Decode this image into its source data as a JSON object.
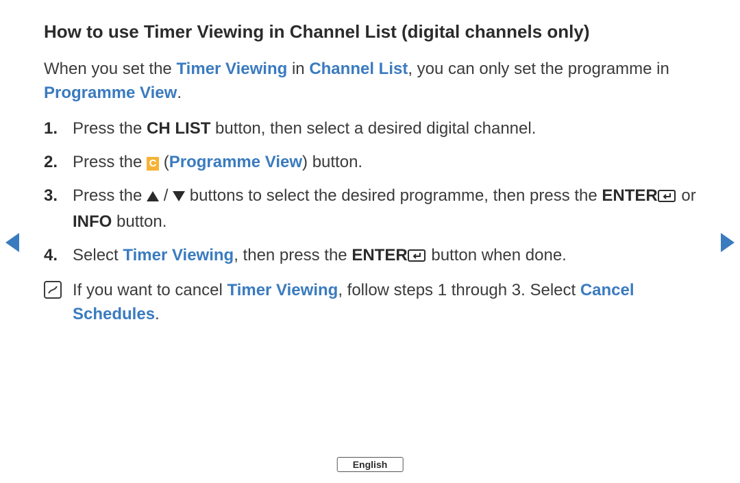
{
  "title": "How to use Timer Viewing in Channel List (digital channels only)",
  "intro": {
    "t1": "When you set the ",
    "timer_viewing": "Timer Viewing",
    "t2": " in ",
    "channel_list": "Channel List",
    "t3": ", you can only set the programme in ",
    "programme_view": "Programme View",
    "t4": "."
  },
  "steps": {
    "s1": {
      "marker": "1.",
      "a": "Press the ",
      "ch_list": "CH LIST",
      "b": " button, then select a desired digital channel."
    },
    "s2": {
      "marker": "2.",
      "a": "Press the ",
      "c_label": "C",
      "b": " (",
      "programme_view": "Programme View",
      "c": ") button."
    },
    "s3": {
      "marker": "3.",
      "a": "Press the ",
      "slash": " / ",
      "b": " buttons to select the desired programme, then press the ",
      "enter": "ENTER",
      "c": " or ",
      "info": "INFO",
      "d": " button."
    },
    "s4": {
      "marker": "4.",
      "a": "Select ",
      "timer_viewing": "Timer Viewing",
      "b": ", then press the ",
      "enter": "ENTER",
      "c": " button when done."
    }
  },
  "note": {
    "a": "If you want to cancel ",
    "timer_viewing": "Timer Viewing",
    "b": ", follow steps 1 through 3. Select ",
    "cancel_schedules": "Cancel Schedules",
    "c": "."
  },
  "language": "English"
}
